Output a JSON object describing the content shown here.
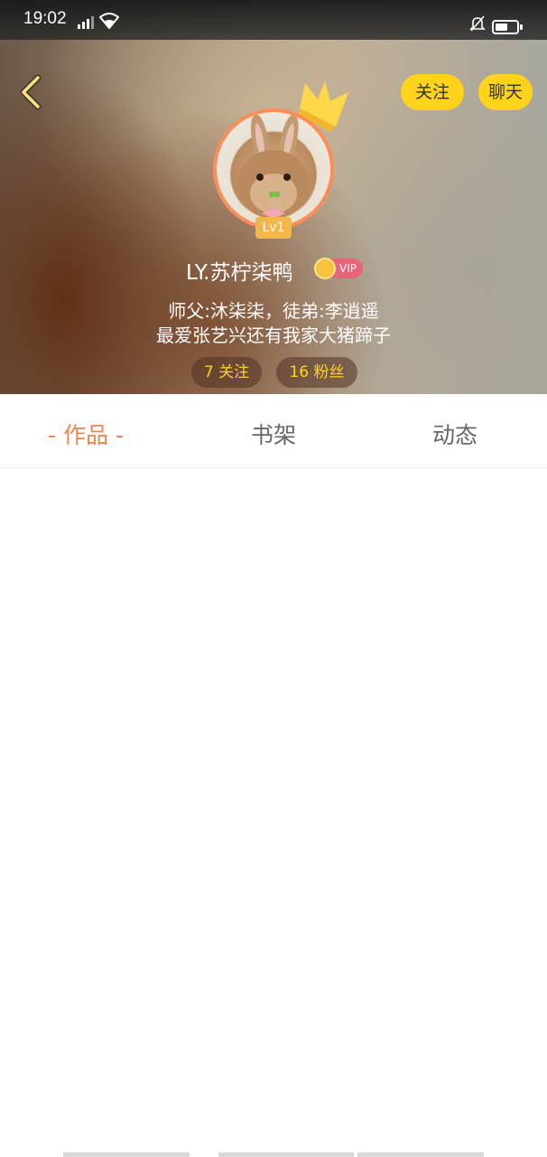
{
  "status_bar": {
    "time": "19:02",
    "signal_label": "E",
    "battery_percent": 60,
    "icons": [
      "signal-icon",
      "wifi-icon",
      "bell-off-icon",
      "battery-icon"
    ]
  },
  "header": {
    "follow_label": "关注",
    "chat_label": "聊天",
    "level": "Lv1",
    "username": "LY.苏柠柒鸭",
    "vip_label": "VIP",
    "bio_line1": "师父:沐柒柒，徒弟:李逍遥",
    "bio_line2": "最爱张艺兴还有我家大猪蹄子",
    "following_count": "7 关注",
    "fans_count": "16 粉丝"
  },
  "tabs": [
    {
      "label": "- 作品 -",
      "active": true
    },
    {
      "label": "书架",
      "active": false
    },
    {
      "label": "动态",
      "active": false
    }
  ],
  "colors": {
    "accent_yellow": "#ffd31a",
    "active_tab": "#f0834a",
    "avatar_ring": "#ff8c59",
    "vip_pink": "#e8647a"
  }
}
